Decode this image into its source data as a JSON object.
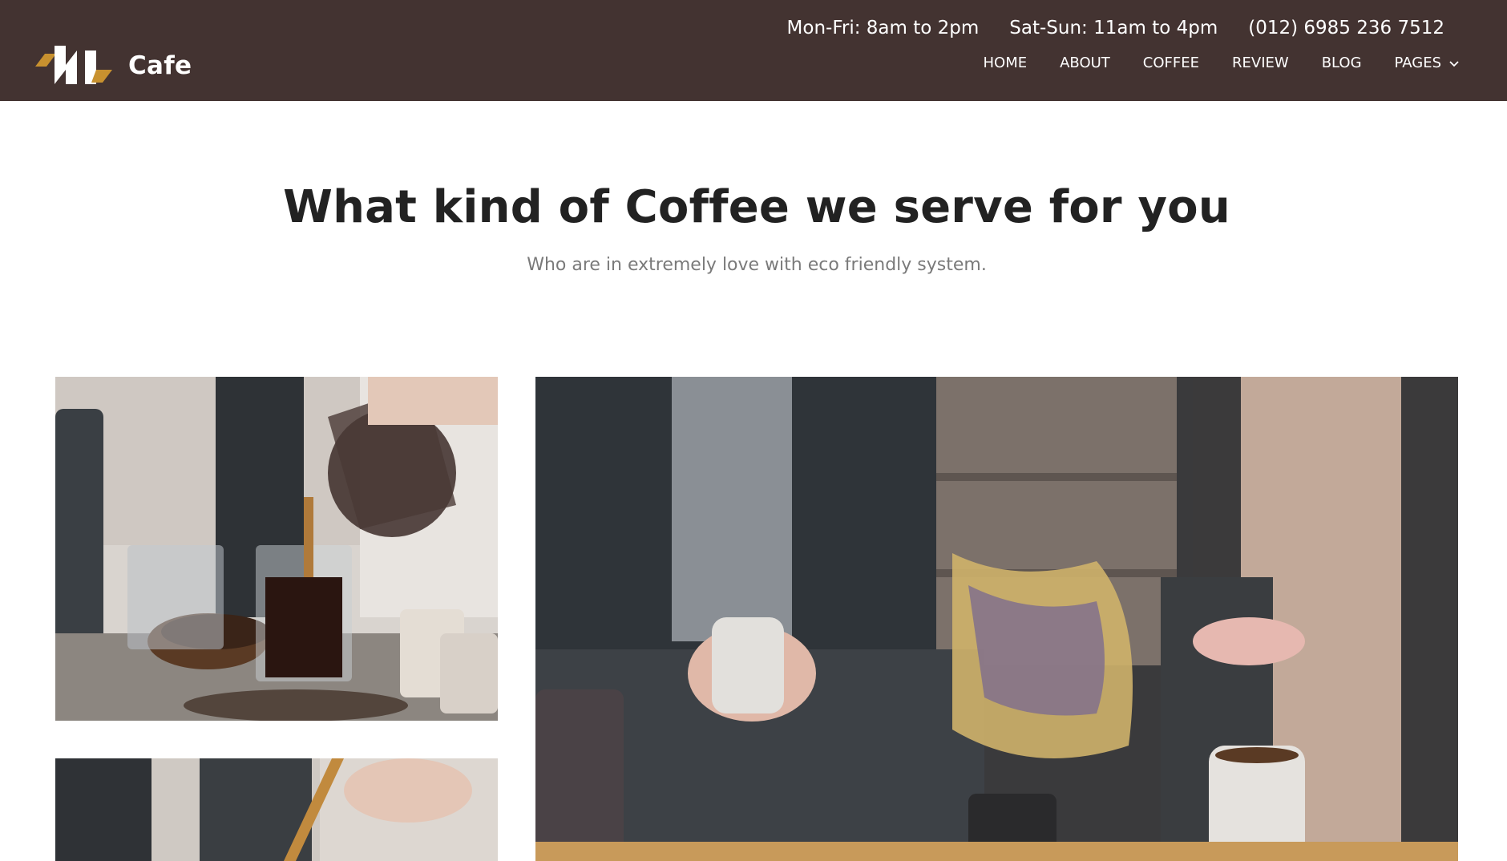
{
  "header": {
    "brand": "Cafe",
    "hours_weekday": "Mon-Fri: 8am to 2pm",
    "hours_weekend": "Sat-Sun: 11am to 4pm",
    "phone": "(012) 6985 236 7512",
    "nav": {
      "home": "HOME",
      "about": "ABOUT",
      "coffee": "COFFEE",
      "review": "REVIEW",
      "blog": "BLOG",
      "pages": "PAGES"
    }
  },
  "section": {
    "title": "What kind of Coffee we serve for you",
    "subtitle": "Who are in extremely love with eco friendly system."
  },
  "colors": {
    "header_bg": "#433331",
    "accent": "#c8912f",
    "heading": "#222222",
    "subtext": "#7a7a7a"
  },
  "icons": {
    "logo": "cafe-logo-icon",
    "dropdown": "chevron-down-icon"
  },
  "images": {
    "photo1": "coffee-pour-photo",
    "photo2": "couple-with-mugs-photo",
    "photo3": "coffee-stir-photo"
  }
}
